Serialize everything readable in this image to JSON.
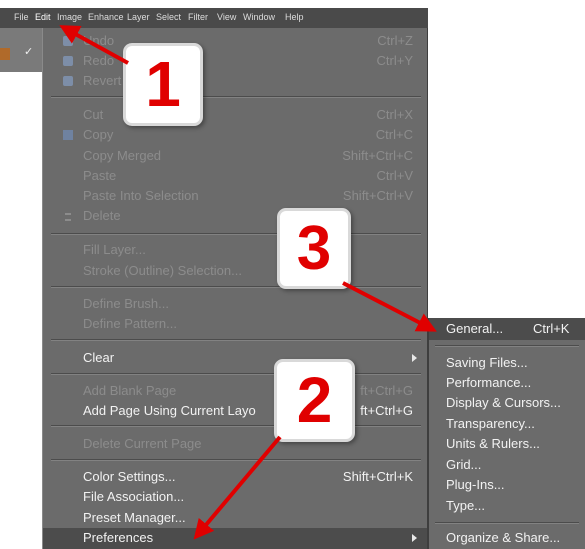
{
  "menubar": {
    "items": [
      "File",
      "Edit",
      "Image",
      "Enhance",
      "Layer",
      "Select",
      "Filter",
      "View",
      "Window",
      "Help"
    ]
  },
  "edit_menu": {
    "undo": {
      "label": "Undo",
      "shortcut": "Ctrl+Z"
    },
    "redo": {
      "label": "Redo",
      "shortcut": "Ctrl+Y"
    },
    "revert": {
      "label": "Revert"
    },
    "cut": {
      "label": "Cut",
      "shortcut": "Ctrl+X"
    },
    "copy": {
      "label": "Copy",
      "shortcut": "Ctrl+C"
    },
    "copy_merged": {
      "label": "Copy Merged",
      "shortcut": "Shift+Ctrl+C"
    },
    "paste": {
      "label": "Paste",
      "shortcut": "Ctrl+V"
    },
    "paste_into_selection": {
      "label": "Paste Into Selection",
      "shortcut": "Shift+Ctrl+V"
    },
    "delete": {
      "label": "Delete"
    },
    "fill_layer": {
      "label": "Fill Layer..."
    },
    "stroke_selection": {
      "label": "Stroke (Outline) Selection..."
    },
    "define_brush": {
      "label": "Define Brush..."
    },
    "define_pattern": {
      "label": "Define Pattern..."
    },
    "clear": {
      "label": "Clear"
    },
    "add_blank_page": {
      "label": "Add Blank Page",
      "shortcut": "ft+Ctrl+G"
    },
    "add_page_using_current_layout": {
      "label": "Add Page Using Current Layo",
      "shortcut": "ft+Ctrl+G"
    },
    "delete_current_page": {
      "label": "Delete Current Page"
    },
    "color_settings": {
      "label": "Color Settings...",
      "shortcut": "Shift+Ctrl+K"
    },
    "file_association": {
      "label": "File Association..."
    },
    "preset_manager": {
      "label": "Preset Manager..."
    },
    "preferences": {
      "label": "Preferences"
    }
  },
  "preferences_submenu": {
    "general": {
      "label": "General...",
      "shortcut": "Ctrl+K"
    },
    "saving_files": "Saving Files...",
    "performance": "Performance...",
    "display_cursors": "Display & Cursors...",
    "transparency": "Transparency...",
    "units_rulers": "Units & Rulers...",
    "grid": "Grid...",
    "plug_ins": "Plug-Ins...",
    "type": "Type...",
    "organize_share": "Organize & Share..."
  },
  "callouts": {
    "step1": "1",
    "step2": "2",
    "step3": "3"
  },
  "colors": {
    "annotation_red": "#e00000",
    "menu_bg": "#6b6b6b",
    "highlight": "#4c4c4c"
  }
}
